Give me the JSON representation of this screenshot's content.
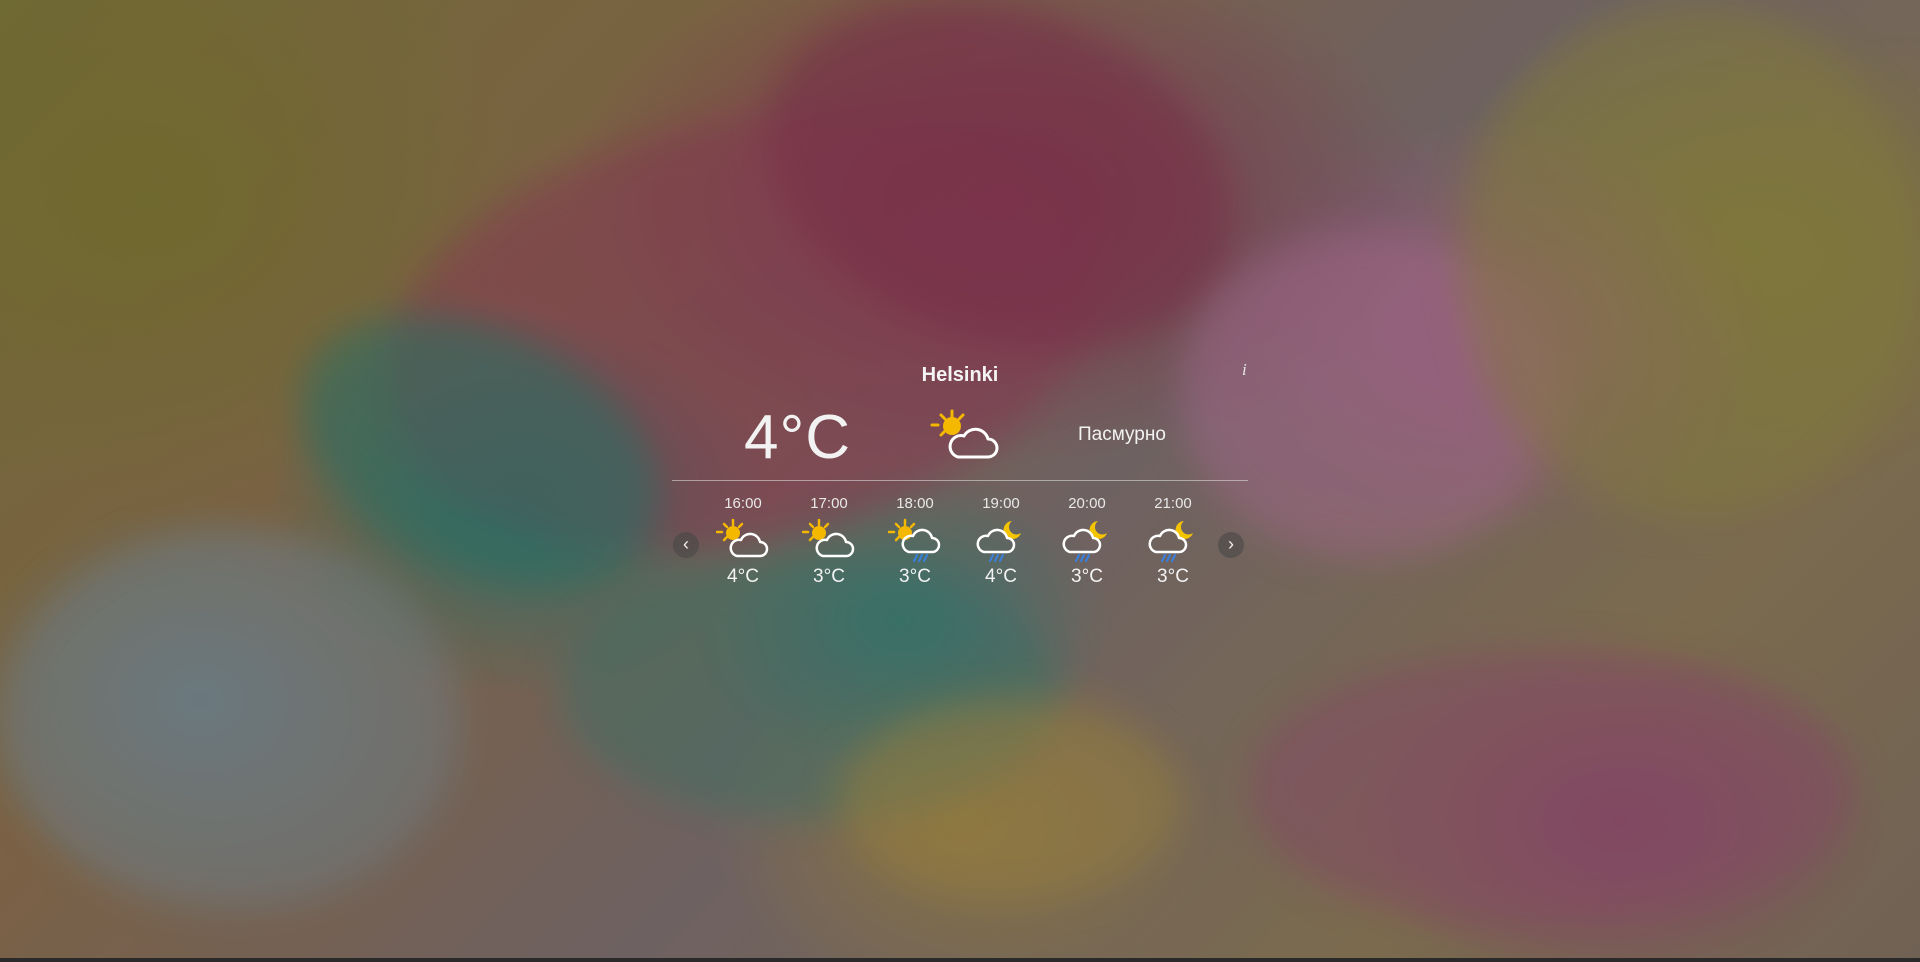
{
  "city": "Helsinki",
  "info_label": "i",
  "current": {
    "temperature": "4°C",
    "icon": "partly-cloudy-day-icon",
    "condition": "Пасмурно"
  },
  "nav": {
    "prev": "‹",
    "next": "›"
  },
  "hourly": [
    {
      "time": "16:00",
      "temp": "4°C",
      "icon": "partly-cloudy-day-icon"
    },
    {
      "time": "17:00",
      "temp": "3°C",
      "icon": "partly-cloudy-day-icon"
    },
    {
      "time": "18:00",
      "temp": "3°C",
      "icon": "partly-cloudy-day-rain-icon"
    },
    {
      "time": "19:00",
      "temp": "4°C",
      "icon": "partly-cloudy-night-rain-icon"
    },
    {
      "time": "20:00",
      "temp": "3°C",
      "icon": "partly-cloudy-night-rain-icon"
    },
    {
      "time": "21:00",
      "temp": "3°C",
      "icon": "partly-cloudy-night-rain-icon"
    }
  ],
  "colors": {
    "sun": "#f5b800",
    "moon": "#f5c400",
    "cloud_stroke": "#ffffff",
    "rain": "#3a7fd8"
  }
}
